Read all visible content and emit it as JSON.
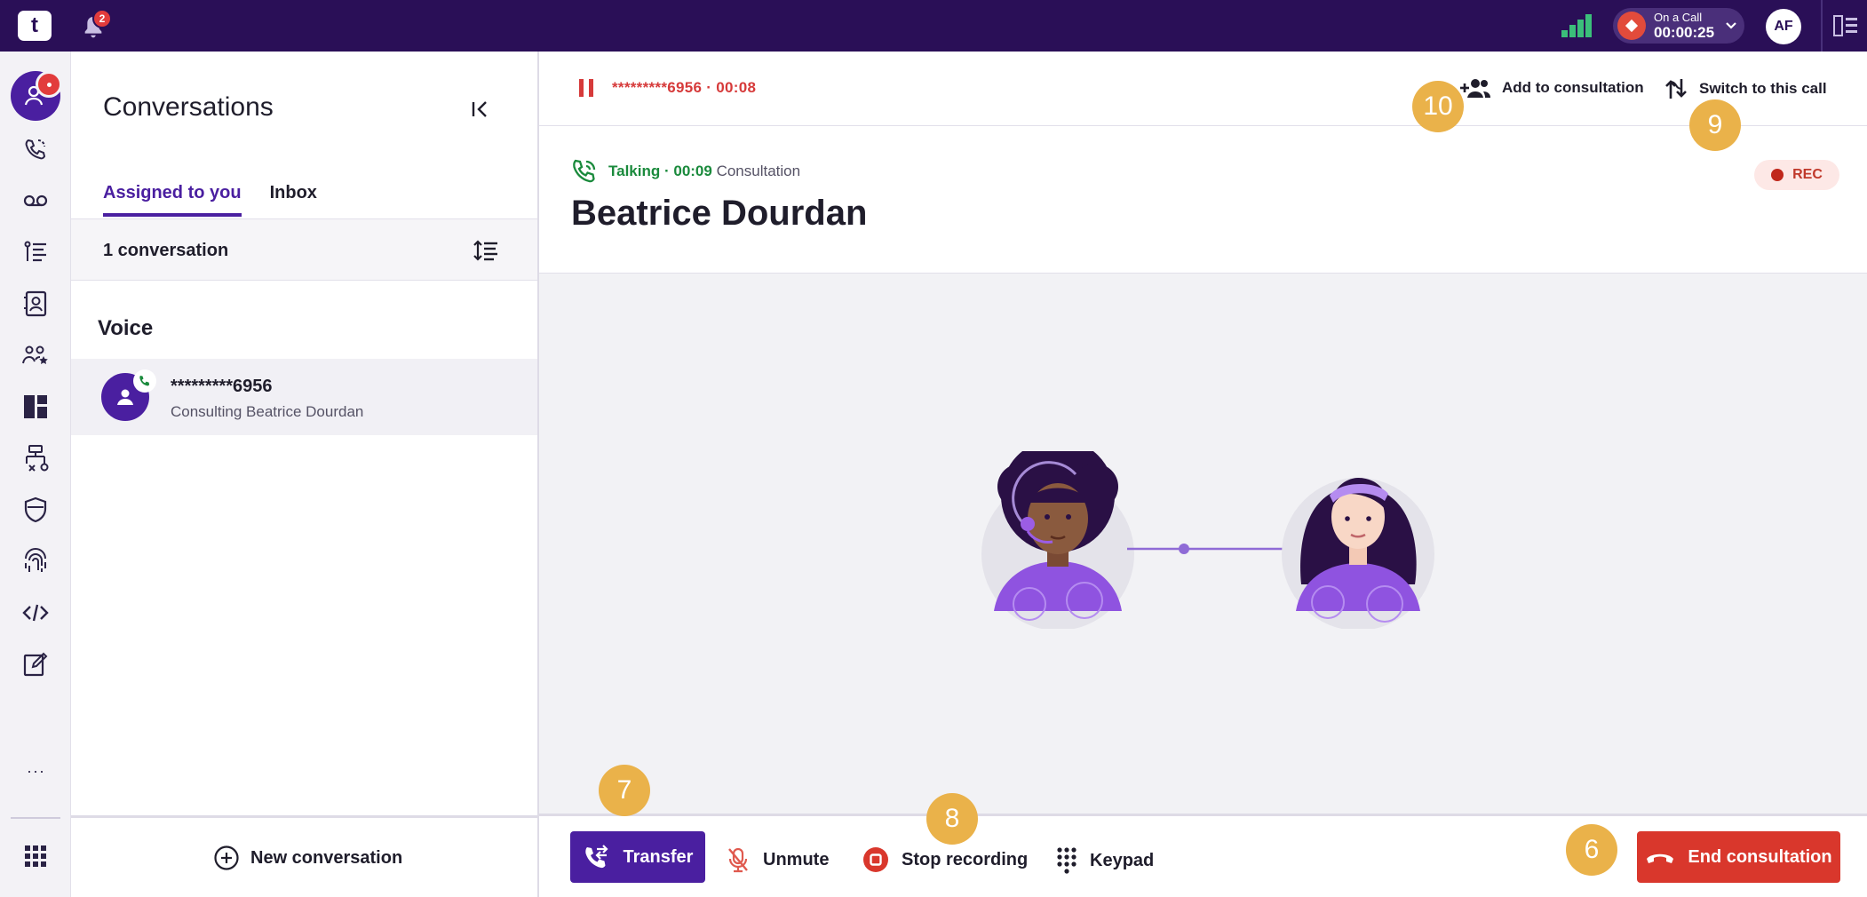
{
  "app": {
    "logo_text": "t",
    "notifications_count": "2",
    "call_status": {
      "label": "On a Call",
      "timer": "00:00:25"
    },
    "user_initials": "AF"
  },
  "rail": {
    "items": [
      "conversations",
      "calls",
      "voicemail",
      "queue",
      "contacts",
      "teams",
      "dashboard",
      "flows",
      "security",
      "biometrics",
      "developer",
      "notes"
    ],
    "more": "···"
  },
  "conversations": {
    "title": "Conversations",
    "tabs": [
      {
        "label": "Assigned to you",
        "active": true
      },
      {
        "label": "Inbox",
        "active": false
      }
    ],
    "count_label": "1 conversation",
    "section_title": "Voice",
    "items": [
      {
        "number": "*********6956",
        "subtitle": "Consulting Beatrice Dourdan"
      }
    ],
    "new_conversation": "New conversation"
  },
  "call": {
    "held": {
      "number": "*********6956",
      "separator": " · ",
      "duration": "00:08"
    },
    "actions": {
      "add_to_consultation": "Add to consultation",
      "switch_to_call": "Switch to this call"
    },
    "status": {
      "state": "Talking",
      "separator": " · ",
      "duration": "00:09",
      "type": "Consultation"
    },
    "contact_name": "Beatrice Dourdan",
    "recording_badge": "REC"
  },
  "controls": {
    "transfer": "Transfer",
    "unmute": "Unmute",
    "stop_recording": "Stop recording",
    "keypad": "Keypad",
    "end_consultation": "End consultation"
  },
  "markers": [
    "6",
    "7",
    "8",
    "9",
    "10"
  ],
  "colors": {
    "brand": "#2a0f57",
    "accent": "#4a1fa0",
    "danger": "#d9372c",
    "talking": "#1a8a3c",
    "marker": "#eab24a"
  }
}
